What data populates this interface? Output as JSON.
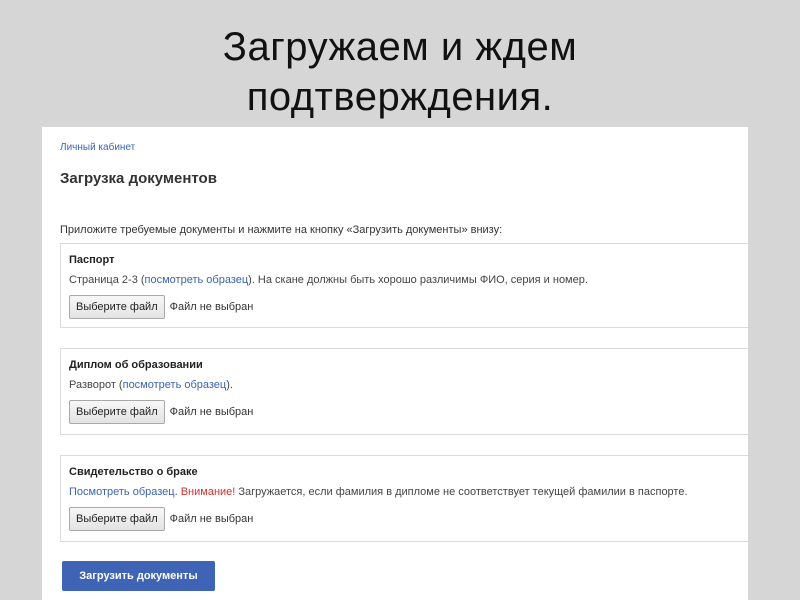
{
  "slide": {
    "title_line1": "Загружаем и ждем",
    "title_line2": "подтверждения."
  },
  "page": {
    "breadcrumb": "Личный кабинет",
    "title": "Загрузка документов",
    "instruction": "Приложите требуемые документы и нажмите на кнопку «Загрузить документы» внизу:"
  },
  "documents": [
    {
      "title": "Паспорт",
      "desc_prefix": "Страница 2-3 (",
      "link": "посмотреть образец",
      "desc_suffix": "). На скане должны быть хорошо различимы ФИО, серия и номер.",
      "button": "Выберите файл",
      "status": "Файл не выбран"
    },
    {
      "title": "Диплом об образовании",
      "desc_prefix": "Разворот (",
      "link": "посмотреть образец",
      "desc_suffix": ").",
      "button": "Выберите файл",
      "status": "Файл не выбран"
    },
    {
      "title": "Свидетельство о браке",
      "link": "Посмотреть образец",
      "desc_mid": ". ",
      "warning": "Внимание!",
      "desc_suffix": " Загружается, если фамилия в дипломе не соответствует текущей фамилии в паспорте.",
      "button": "Выберите файл",
      "status": "Файл не выбран"
    }
  ],
  "submit_label": "Загрузить документы",
  "colors": {
    "link": "#3b63b5",
    "warning": "#d32f2f",
    "primary": "#3f64b5"
  }
}
